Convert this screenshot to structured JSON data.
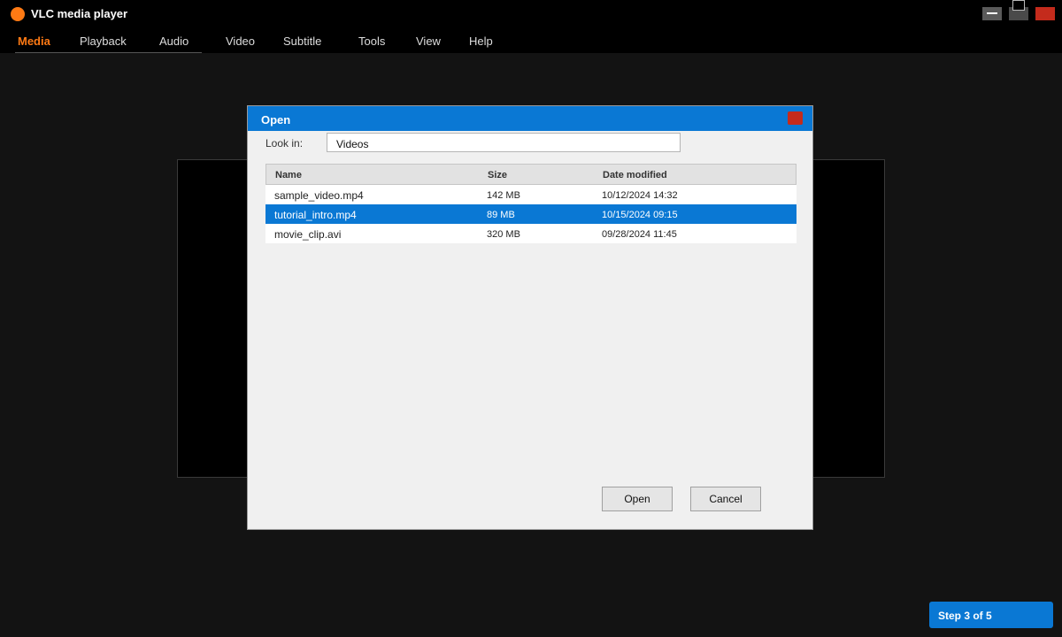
{
  "app": {
    "title": "VLC media player",
    "logo_icon": "vlc-cone-icon",
    "accent_color": "#ff7a14"
  },
  "window_controls": {
    "minimize_icon": "minimize-icon",
    "maximize_icon": "maximize-icon",
    "close_icon": "close-icon"
  },
  "menu": {
    "items": [
      {
        "label": "Media",
        "active": true
      },
      {
        "label": "Playback"
      },
      {
        "label": "Audio"
      },
      {
        "label": "Video"
      },
      {
        "label": "Subtitle"
      },
      {
        "label": "Tools"
      },
      {
        "label": "View"
      },
      {
        "label": "Help"
      }
    ]
  },
  "dialog": {
    "title": "Open",
    "titlebar_color": "#0a78d4",
    "look_in_label": "Look in:",
    "look_in_value": "Videos",
    "columns": {
      "name": "Name",
      "size": "Size",
      "date": "Date modified"
    },
    "files": [
      {
        "name": "sample_video.mp4",
        "size": "142 MB",
        "date": "10/12/2024 14:32"
      },
      {
        "name": "tutorial_intro.mp4",
        "size": "89 MB",
        "date": "10/15/2024 09:15",
        "selected": true
      },
      {
        "name": "movie_clip.avi",
        "size": "320 MB",
        "date": "09/28/2024 11:45"
      }
    ],
    "open_label": "Open",
    "cancel_label": "Cancel"
  },
  "step": {
    "label": "Step 3 of 5"
  }
}
